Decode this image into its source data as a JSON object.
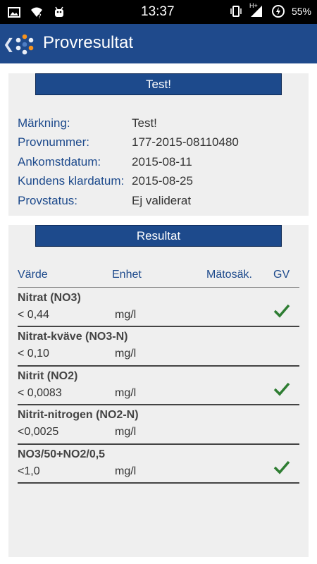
{
  "statusbar": {
    "time": "13:37",
    "network": "H+",
    "battery": "55%",
    "icons": [
      "image-icon",
      "wifi-question-icon",
      "android-debug-icon",
      "vibrate-icon",
      "signal-icon",
      "battery-icon"
    ]
  },
  "appbar": {
    "title": "Provresultat"
  },
  "sample": {
    "header": "Test!",
    "fields": [
      {
        "label": "Märkning:",
        "value": "Test!"
      },
      {
        "label": "Provnummer:",
        "value": "177-2015-08110480"
      },
      {
        "label": "Ankomstdatum:",
        "value": "2015-08-11"
      },
      {
        "label": "Kundens klardatum:",
        "value": "2015-08-25"
      },
      {
        "label": "Provstatus:",
        "value": "Ej validerat"
      }
    ]
  },
  "results": {
    "header": "Resultat",
    "columns": {
      "value": "Värde",
      "unit": "Enhet",
      "uncertainty": "Mätosäk.",
      "gv": "GV"
    },
    "rows": [
      {
        "name": "Nitrat (NO3)",
        "value": "< 0,44",
        "unit": "mg/l",
        "gv": true
      },
      {
        "name": "Nitrat-kväve (NO3-N)",
        "value": "< 0,10",
        "unit": "mg/l",
        "gv": false
      },
      {
        "name": "Nitrit (NO2)",
        "value": "< 0,0083",
        "unit": "mg/l",
        "gv": true
      },
      {
        "name": "Nitrit-nitrogen (NO2-N)",
        "value": "<0,0025",
        "unit": "mg/l",
        "gv": false
      },
      {
        "name": "NO3/50+NO2/0,5",
        "value": "<1,0",
        "unit": "mg/l",
        "gv": true
      }
    ],
    "check_color": "#2e7d32"
  },
  "colors": {
    "appbar": "#1f4a8c",
    "accent": "#1d4a8c"
  }
}
